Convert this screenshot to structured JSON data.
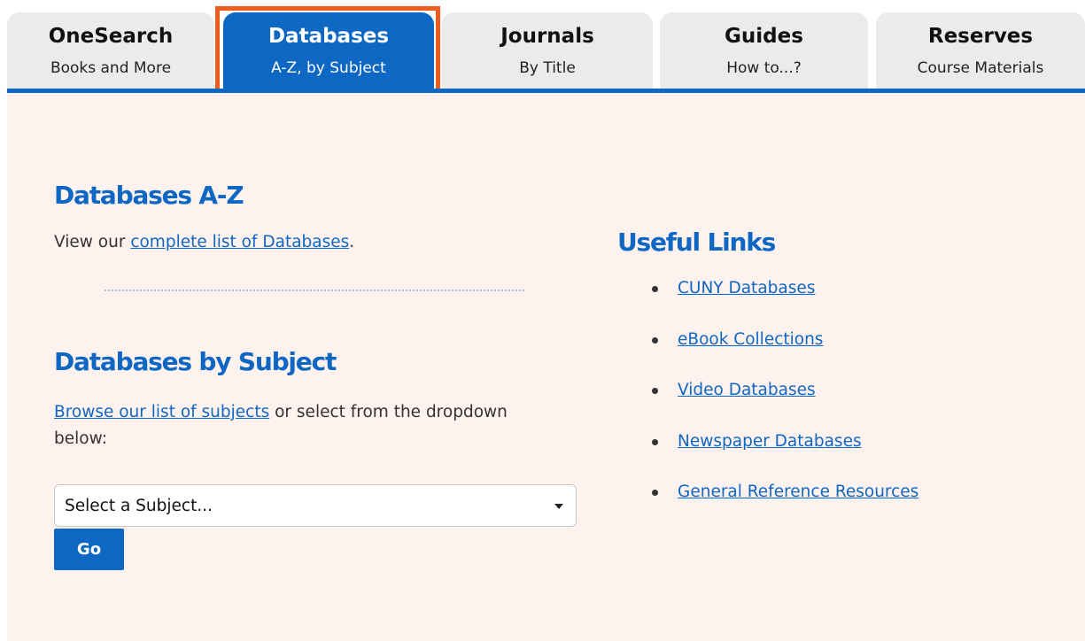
{
  "tabs": [
    {
      "title": "OneSearch",
      "subtitle": "Books and More",
      "active": false
    },
    {
      "title": "Databases",
      "subtitle": "A-Z, by Subject",
      "active": true
    },
    {
      "title": "Journals",
      "subtitle": "By Title",
      "active": false
    },
    {
      "title": "Guides",
      "subtitle": "How to...?",
      "active": false
    },
    {
      "title": "Reserves",
      "subtitle": "Course Materials",
      "active": false
    }
  ],
  "databases_az": {
    "heading": "Databases A-Z",
    "text_before": "View our ",
    "link": "complete list of Databases",
    "text_after": "."
  },
  "databases_by_subject": {
    "heading": "Databases by Subject",
    "link": "Browse our list of subjects",
    "text_after": " or select from the dropdown below:",
    "select_value": "Select a Subject...",
    "go_label": "Go"
  },
  "useful_links": {
    "heading": "Useful Links",
    "items": [
      {
        "label": "CUNY Databases"
      },
      {
        "label": "eBook Collections"
      },
      {
        "label": "Video Databases"
      },
      {
        "label": "Newspaper Databases"
      },
      {
        "label": "General Reference Resources"
      }
    ]
  },
  "colors": {
    "brand_blue": "#0f67c4",
    "highlight_orange": "#ec5c1c",
    "panel_background": "#fdf2ee",
    "inactive_tab": "#ebebeb"
  },
  "icons": {
    "select_caret": "chevron-down-icon",
    "list_bullet": "bullet-icon"
  }
}
